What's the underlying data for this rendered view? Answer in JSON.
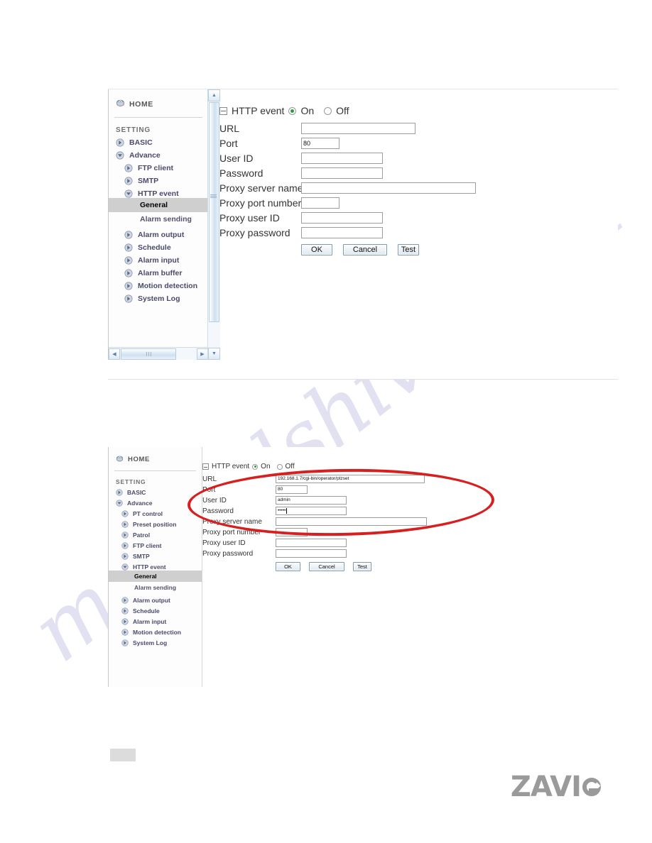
{
  "watermark": {
    "text": "manualshive.com"
  },
  "panels": [
    {
      "id": "panel-top",
      "sidebar": {
        "home_label": "HOME",
        "setting_label": "SETTING",
        "items": [
          {
            "label": "BASIC",
            "level": 1,
            "state": "collapsed"
          },
          {
            "label": "Advance",
            "level": 1,
            "state": "expanded"
          },
          {
            "label": "FTP client",
            "level": 2,
            "state": "collapsed"
          },
          {
            "label": "SMTP",
            "level": 2,
            "state": "collapsed"
          },
          {
            "label": "HTTP event",
            "level": 2,
            "state": "expanded"
          }
        ],
        "sub_items": [
          {
            "label": "General",
            "selected": true
          },
          {
            "label": "Alarm sending",
            "selected": false
          }
        ],
        "items_after": [
          {
            "label": "Alarm output",
            "level": 2,
            "state": "collapsed"
          },
          {
            "label": "Schedule",
            "level": 2,
            "state": "collapsed"
          },
          {
            "label": "Alarm input",
            "level": 2,
            "state": "collapsed"
          },
          {
            "label": "Alarm buffer",
            "level": 2,
            "state": "collapsed"
          },
          {
            "label": "Motion detection",
            "level": 2,
            "state": "collapsed"
          },
          {
            "label": "System Log",
            "level": 2,
            "state": "collapsed"
          }
        ]
      },
      "form": {
        "title": "HTTP event",
        "on_label": "On",
        "off_label": "Off",
        "selected_radio": "On",
        "fields": [
          {
            "label": "URL",
            "value": "",
            "width": "url"
          },
          {
            "label": "Port",
            "value": "80",
            "width": "port"
          },
          {
            "label": "User ID",
            "value": "",
            "width": "mid"
          },
          {
            "label": "Password",
            "value": "",
            "width": "mid"
          },
          {
            "label": "Proxy server name",
            "value": "",
            "width": "proxy"
          },
          {
            "label": "Proxy port number",
            "value": "",
            "width": "pport"
          },
          {
            "label": "Proxy user ID",
            "value": "",
            "width": "mid"
          },
          {
            "label": "Proxy password",
            "value": "",
            "width": "mid"
          }
        ],
        "buttons": {
          "ok": "OK",
          "cancel": "Cancel",
          "test": "Test"
        }
      }
    },
    {
      "id": "panel-bottom",
      "sidebar": {
        "home_label": "HOME",
        "setting_label": "SETTING",
        "items": [
          {
            "label": "BASIC",
            "level": 1,
            "state": "collapsed"
          },
          {
            "label": "Advance",
            "level": 1,
            "state": "expanded"
          },
          {
            "label": "PT control",
            "level": 2,
            "state": "collapsed"
          },
          {
            "label": "Preset position",
            "level": 2,
            "state": "collapsed"
          },
          {
            "label": "Patrol",
            "level": 2,
            "state": "collapsed"
          },
          {
            "label": "FTP client",
            "level": 2,
            "state": "collapsed"
          },
          {
            "label": "SMTP",
            "level": 2,
            "state": "collapsed"
          },
          {
            "label": "HTTP event",
            "level": 2,
            "state": "expanded"
          }
        ],
        "sub_items": [
          {
            "label": "General",
            "selected": true
          },
          {
            "label": "Alarm sending",
            "selected": false
          }
        ],
        "items_after": [
          {
            "label": "Alarm output",
            "level": 2,
            "state": "collapsed"
          },
          {
            "label": "Schedule",
            "level": 2,
            "state": "collapsed"
          },
          {
            "label": "Alarm input",
            "level": 2,
            "state": "collapsed"
          },
          {
            "label": "Motion detection",
            "level": 2,
            "state": "collapsed"
          },
          {
            "label": "System Log",
            "level": 2,
            "state": "collapsed"
          }
        ]
      },
      "form": {
        "title": "HTTP event",
        "on_label": "On",
        "off_label": "Off",
        "selected_radio": "On",
        "fields": [
          {
            "label": "URL",
            "value": "192.168.1.7/cgi-bin/operator/ptzset",
            "width": "url"
          },
          {
            "label": "Port",
            "value": "80",
            "width": "port"
          },
          {
            "label": "User ID",
            "value": "admin",
            "width": "mid"
          },
          {
            "label": "Password",
            "value": "•••••",
            "width": "mid"
          },
          {
            "label": "Proxy server name",
            "value": "",
            "width": "proxy"
          },
          {
            "label": "Proxy port number",
            "value": "",
            "width": "pport"
          },
          {
            "label": "Proxy user ID",
            "value": "",
            "width": "mid"
          },
          {
            "label": "Proxy password",
            "value": "",
            "width": "mid"
          }
        ],
        "buttons": {
          "ok": "OK",
          "cancel": "Cancel",
          "test": "Test"
        }
      }
    }
  ],
  "annotation": {
    "shape": "red-ellipse",
    "color": "#d81f1f"
  },
  "footer": {
    "logo_text": "ZAVI",
    "logo_color": "#9a9a9a"
  },
  "colors": {
    "accent_blue": "#b9cde0",
    "selected_row": "#cfcfcf",
    "radio_on": "#2e9b3e",
    "annotation_red": "#d81f1f",
    "watermark": "#c9c9e8"
  }
}
